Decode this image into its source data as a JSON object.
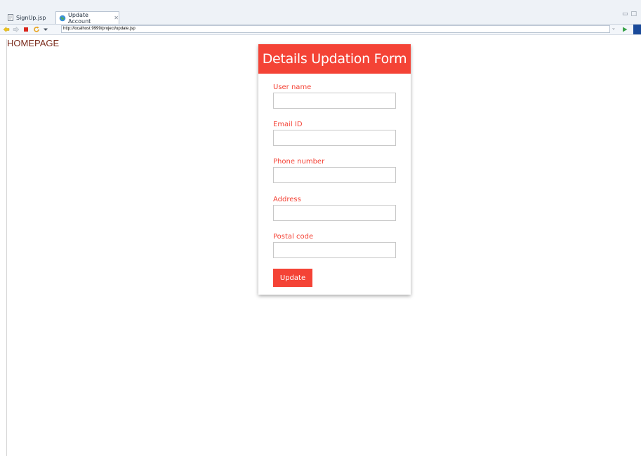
{
  "tabs": [
    {
      "label": "SignUp.jsp",
      "icon": "file-icon"
    },
    {
      "label": "Update Account",
      "icon": "globe-icon",
      "close_glyph": "✕"
    }
  ],
  "toolbar": {
    "url": "http://localhost:9999/project/update.jsp"
  },
  "page": {
    "homepage_link": "HOMEPAGE",
    "form": {
      "title": "Details Updation Form",
      "fields": [
        {
          "label": "User name",
          "value": ""
        },
        {
          "label": "Email ID",
          "value": ""
        },
        {
          "label": "Phone number",
          "value": ""
        },
        {
          "label": "Address",
          "value": ""
        },
        {
          "label": "Postal code",
          "value": ""
        }
      ],
      "submit_label": "Update"
    }
  },
  "colors": {
    "accent": "#f44336",
    "homepage_link": "#7a2a1a"
  }
}
